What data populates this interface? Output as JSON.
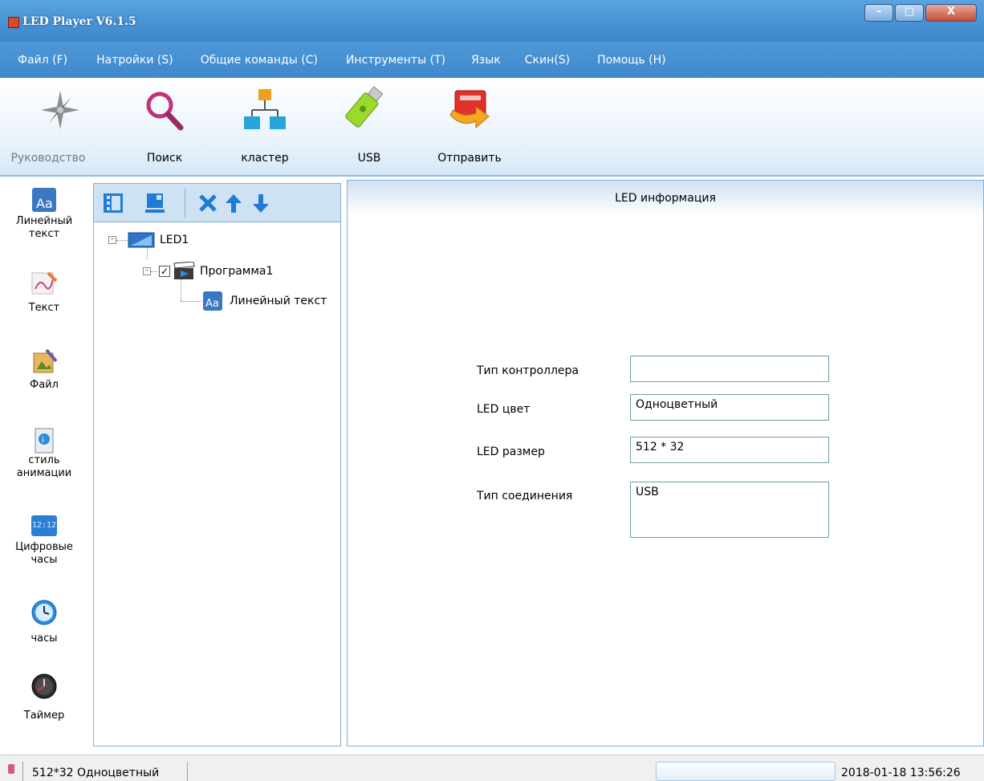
{
  "window": {
    "title": "LED Player V6.1.5",
    "controls": {
      "minimize": "–",
      "maximize": "□",
      "close": "X"
    }
  },
  "menu": [
    "Файл (F)",
    "Натройки (S)",
    "Общие команды (C)",
    "Инструменты (T)",
    "Язык",
    "Скин(S)",
    "Помощь (H)"
  ],
  "toolbar": {
    "guide": {
      "label": "Руководство",
      "icon": "compass-star-icon",
      "disabled": true
    },
    "search": {
      "label": "Поиск",
      "icon": "magnifier-icon"
    },
    "cluster": {
      "label": "кластер",
      "icon": "network-cluster-icon"
    },
    "usb": {
      "label": "USB",
      "icon": "usb-drive-icon"
    },
    "send": {
      "label": "Отправить",
      "icon": "send-device-icon"
    }
  },
  "palette": [
    {
      "label_lines": [
        "Линейный",
        "текст"
      ],
      "icon": "line-text-icon"
    },
    {
      "label_lines": [
        "Текст"
      ],
      "icon": "text-brush-icon"
    },
    {
      "label_lines": [
        "Файл"
      ],
      "icon": "file-picture-icon"
    },
    {
      "label_lines": [
        "стиль",
        "анимации"
      ],
      "icon": "animation-style-icon"
    },
    {
      "label_lines": [
        "Цифровые",
        "часы"
      ],
      "icon": "digital-clock-icon",
      "icon_text": "12:12"
    },
    {
      "label_lines": [
        "часы"
      ],
      "icon": "analog-clock-icon"
    },
    {
      "label_lines": [
        "Таймер"
      ],
      "icon": "timer-icon"
    }
  ],
  "tree": {
    "toolbar_icons": [
      "add-program-icon",
      "add-area-icon",
      "delete-icon",
      "move-up-icon",
      "move-down-icon"
    ],
    "nodes": {
      "led": "LED1",
      "program": "Программа1",
      "program_checked": true,
      "item": "Линейный текст"
    }
  },
  "info": {
    "title": "LED информация",
    "fields": {
      "controller_type": {
        "label": "Тип контроллера",
        "value": ""
      },
      "led_color": {
        "label": "LED цвет",
        "value": "Одноцветный"
      },
      "led_size": {
        "label": "LED размер",
        "value": "512 * 32"
      },
      "connection_type": {
        "label": "Тип соединения",
        "value": "USB"
      }
    }
  },
  "status": {
    "text": "512*32 Одноцветный",
    "datetime": "2018-01-18 13:56:26"
  },
  "colors": {
    "title_bar": "#3b86cd",
    "menu_bar": "#4690d2",
    "panel_border": "#7fb0da",
    "field_border": "#6f9ea5",
    "tree_toolbar_icons": "#1f7bd6"
  }
}
